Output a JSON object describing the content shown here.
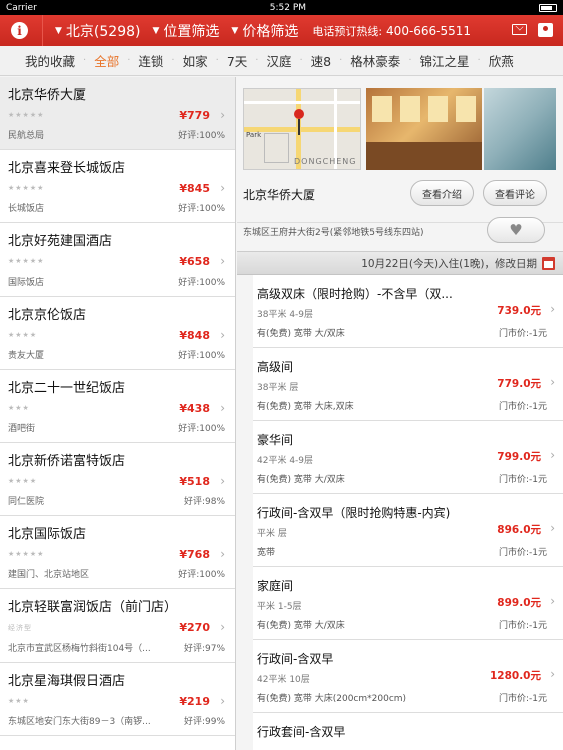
{
  "status": {
    "carrier": "Carrier",
    "time": "5:52 PM"
  },
  "topbar": {
    "city": "北京(5298)",
    "location_filter": "位置筛选",
    "price_filter": "价格筛选",
    "hotline_label": "电话预订热线:",
    "hotline_number": "400-666-5511"
  },
  "tabs": [
    "我的收藏",
    "全部",
    "连锁",
    "如家",
    "7天",
    "汉庭",
    "速8",
    "格林豪泰",
    "锦江之星",
    "欣燕"
  ],
  "active_tab": "全部",
  "hotels": [
    {
      "name": "北京华侨大厦",
      "stars": "★★★★★",
      "price": "¥779",
      "area": "民航总局",
      "rating": "好评:100%"
    },
    {
      "name": "北京喜来登长城饭店",
      "stars": "★★★★★",
      "price": "¥845",
      "area": "长城饭店",
      "rating": "好评:100%"
    },
    {
      "name": "北京好苑建国酒店",
      "stars": "★★★★★",
      "price": "¥658",
      "area": "国际饭店",
      "rating": "好评:100%"
    },
    {
      "name": "北京京伦饭店",
      "stars": "★★★★",
      "price": "¥848",
      "area": "贵友大厦",
      "rating": "好评:100%"
    },
    {
      "name": "北京二十一世纪饭店",
      "stars": "★★★",
      "price": "¥438",
      "area": "酒吧街",
      "rating": "好评:100%"
    },
    {
      "name": "北京新侨诺富特饭店",
      "stars": "★★★★",
      "price": "¥518",
      "area": "同仁医院",
      "rating": "好评:98%"
    },
    {
      "name": "北京国际饭店",
      "stars": "★★★★★",
      "price": "¥768",
      "area": "建国门、北京站地区",
      "rating": "好评:100%"
    },
    {
      "name": "北京轻联富润饭店（前门店）",
      "stars": "经济型",
      "price": "¥270",
      "area": "北京市宣武区杨梅竹斜街104号（...",
      "rating": "好评:97%"
    },
    {
      "name": "北京星海琪假日酒店",
      "stars": "★★★",
      "price": "¥219",
      "area": "东城区地安门东大街89－3（南锣...",
      "rating": "好评:99%"
    }
  ],
  "detail": {
    "map_labels": {
      "park": "Park",
      "district": "DONGCHENG"
    },
    "name": "北京华侨大厦",
    "intro_button": "查看介绍",
    "review_button": "查看评论",
    "address": "东城区王府井大街2号(紧邻地铁5号线东四站)",
    "date_bar": "10月22日(今天)入住(1晚)，修改日期",
    "rooms": [
      {
        "name": "高级双床（限时抢购）-不含早（双...",
        "size": "38平米 4-9层",
        "bed": "有(免费) 宽带 大/双床",
        "price": "739.0元",
        "market": "门市价:-1元"
      },
      {
        "name": "高级间",
        "size": "38平米 层",
        "bed": "有(免费) 宽带 大床,双床",
        "price": "779.0元",
        "market": "门市价:-1元"
      },
      {
        "name": "豪华间",
        "size": "42平米 4-9层",
        "bed": "有(免费) 宽带 大/双床",
        "price": "799.0元",
        "market": "门市价:-1元"
      },
      {
        "name": "行政间-含双早（限时抢购特惠-内宾)",
        "size": "平米 层",
        "bed": "宽带",
        "price": "896.0元",
        "market": "门市价:-1元"
      },
      {
        "name": "家庭间",
        "size": " 平米 1-5层",
        "bed": "有(免费) 宽带 大/双床",
        "price": "899.0元",
        "market": "门市价:-1元"
      },
      {
        "name": "行政间-含双早",
        "size": "42平米 10层",
        "bed": "有(免费) 宽带 大床(200cm*200cm)",
        "price": "1280.0元",
        "market": "门市价:-1元"
      },
      {
        "name": "行政套间-含双早",
        "size": "",
        "bed": "",
        "price": "",
        "market": ""
      }
    ]
  },
  "colors": {
    "brand_red": "#c8281f",
    "price_red": "#e0271d",
    "active_tab": "#e8742a"
  }
}
